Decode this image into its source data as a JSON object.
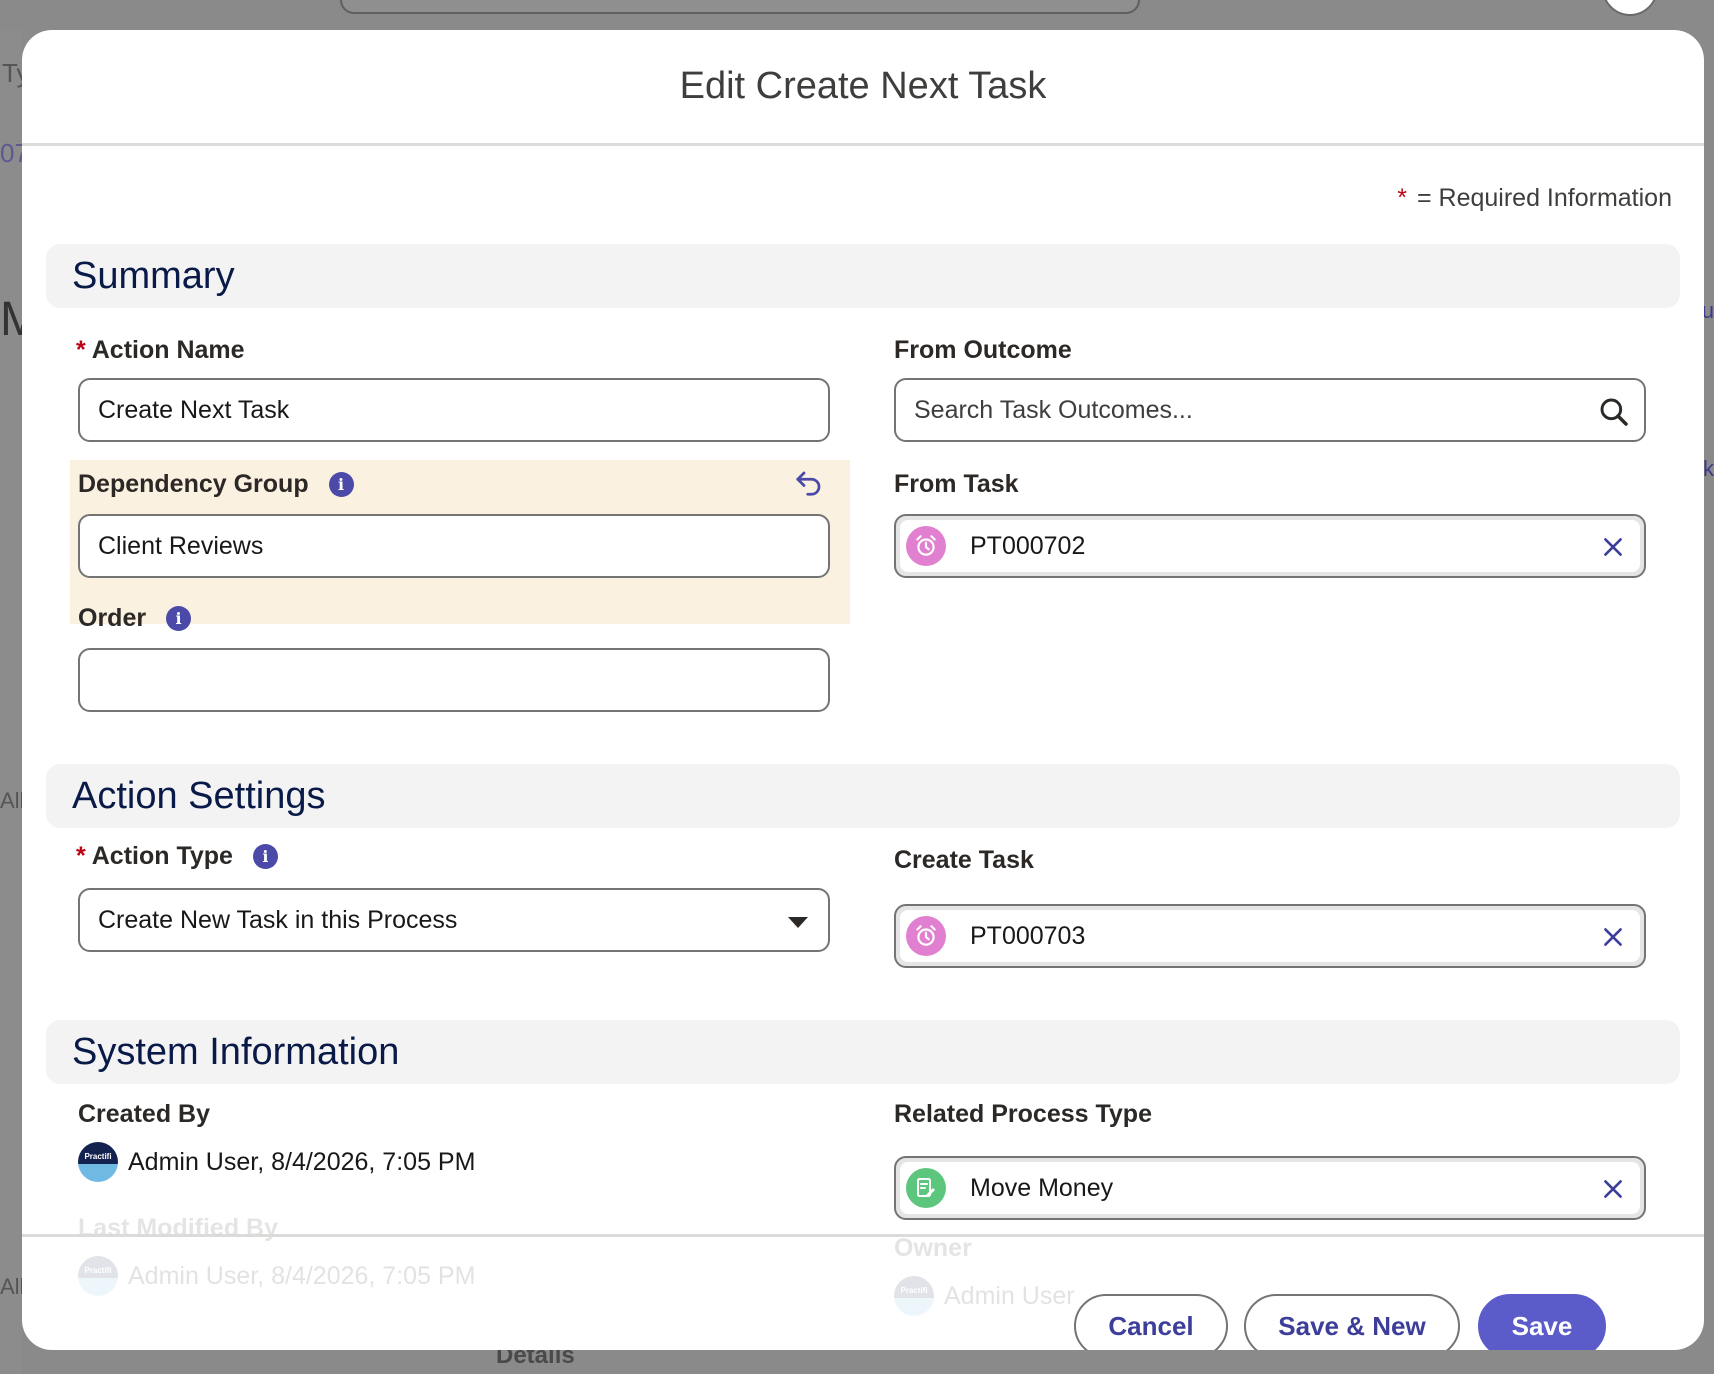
{
  "background": {
    "fragments": [
      "Ty",
      "07",
      "M",
      "All",
      "All",
      "u",
      "ck"
    ],
    "bottom_label": "Details"
  },
  "modal": {
    "title": "Edit Create Next Task",
    "required_legend": "= Required Information",
    "required_star": "*"
  },
  "sections": {
    "summary": "Summary",
    "action_settings": "Action Settings",
    "system_information": "System Information"
  },
  "summary": {
    "action_name": {
      "label": "Action Name",
      "value": "Create Next Task",
      "required": true
    },
    "from_outcome": {
      "label": "From Outcome",
      "placeholder": "Search Task Outcomes..."
    },
    "dependency_group": {
      "label": "Dependency Group",
      "value": "Client Reviews"
    },
    "from_task": {
      "label": "From Task",
      "value": "PT000702"
    },
    "order": {
      "label": "Order",
      "value": ""
    }
  },
  "action_settings": {
    "action_type": {
      "label": "Action Type",
      "value": "Create New Task in this Process",
      "required": true
    },
    "create_task": {
      "label": "Create Task",
      "value": "PT000703"
    }
  },
  "system_information": {
    "created_by": {
      "label": "Created By",
      "value": "Admin User, 8/4/2026, 7:05 PM",
      "avatar_text": "Practifi"
    },
    "related_process_type": {
      "label": "Related Process Type",
      "value": "Move Money"
    },
    "last_modified_by": {
      "label": "Last Modified By",
      "value": "Admin User, 8/4/2026, 7:05 PM",
      "avatar_text": "Practifi"
    },
    "owner": {
      "label": "Owner",
      "value": "Admin User",
      "avatar_text": "Practifi"
    }
  },
  "footer": {
    "cancel": "Cancel",
    "save_new": "Save & New",
    "save": "Save"
  },
  "colors": {
    "brand": "#5b5bc9",
    "required": "#ba0517",
    "section_title": "#0a1a48",
    "highlight": "#faf1e1",
    "task_icon": "#e17fd0",
    "process_icon": "#5cc67d"
  },
  "icons": [
    "search-icon",
    "info-icon",
    "undo-icon",
    "alarm-clock-icon",
    "close-icon",
    "chevron-down-icon",
    "document-edit-icon",
    "avatar"
  ]
}
